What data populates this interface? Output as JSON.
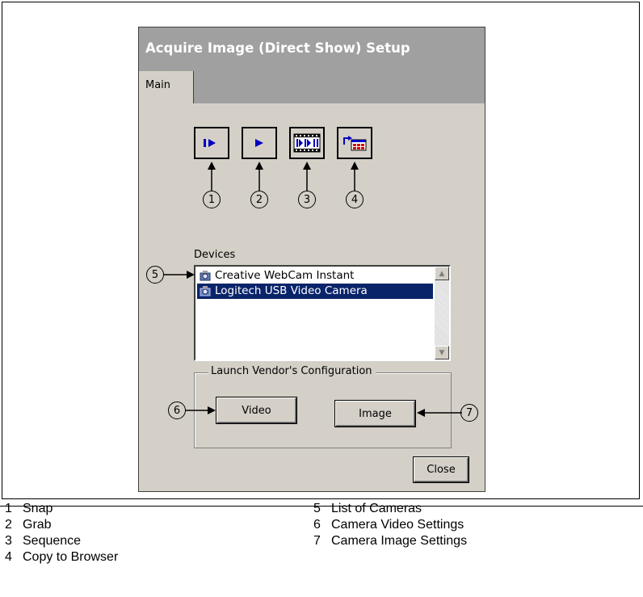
{
  "dialog": {
    "title": "Acquire Image (Direct Show) Setup",
    "tabs": [
      "Main"
    ],
    "toolbar_icons": [
      "snap-icon",
      "grab-icon",
      "sequence-icon",
      "copy-to-browser-icon"
    ],
    "callouts": [
      "1",
      "2",
      "3",
      "4",
      "5",
      "6",
      "7"
    ],
    "devices_label": "Devices",
    "devices": [
      {
        "label": "Creative WebCam Instant",
        "selected": false
      },
      {
        "label": "Logitech USB Video Camera",
        "selected": true
      }
    ],
    "group_label": "Launch Vendor's Configuration",
    "video_button": "Video",
    "image_button": "Image",
    "close_button": "Close"
  },
  "legend": [
    {
      "num": "1",
      "text": "Snap"
    },
    {
      "num": "2",
      "text": "Grab"
    },
    {
      "num": "3",
      "text": "Sequence"
    },
    {
      "num": "4",
      "text": "Copy to Browser"
    },
    {
      "num": "5",
      "text": "List of Cameras"
    },
    {
      "num": "6",
      "text": "Camera Video Settings"
    },
    {
      "num": "7",
      "text": "Camera Image Settings"
    }
  ],
  "colors": {
    "dialog_bg": "#d4d0c8",
    "titlebar": "#a0a0a0",
    "selection": "#0a246a",
    "toolbar_icon": "#0000c0"
  }
}
